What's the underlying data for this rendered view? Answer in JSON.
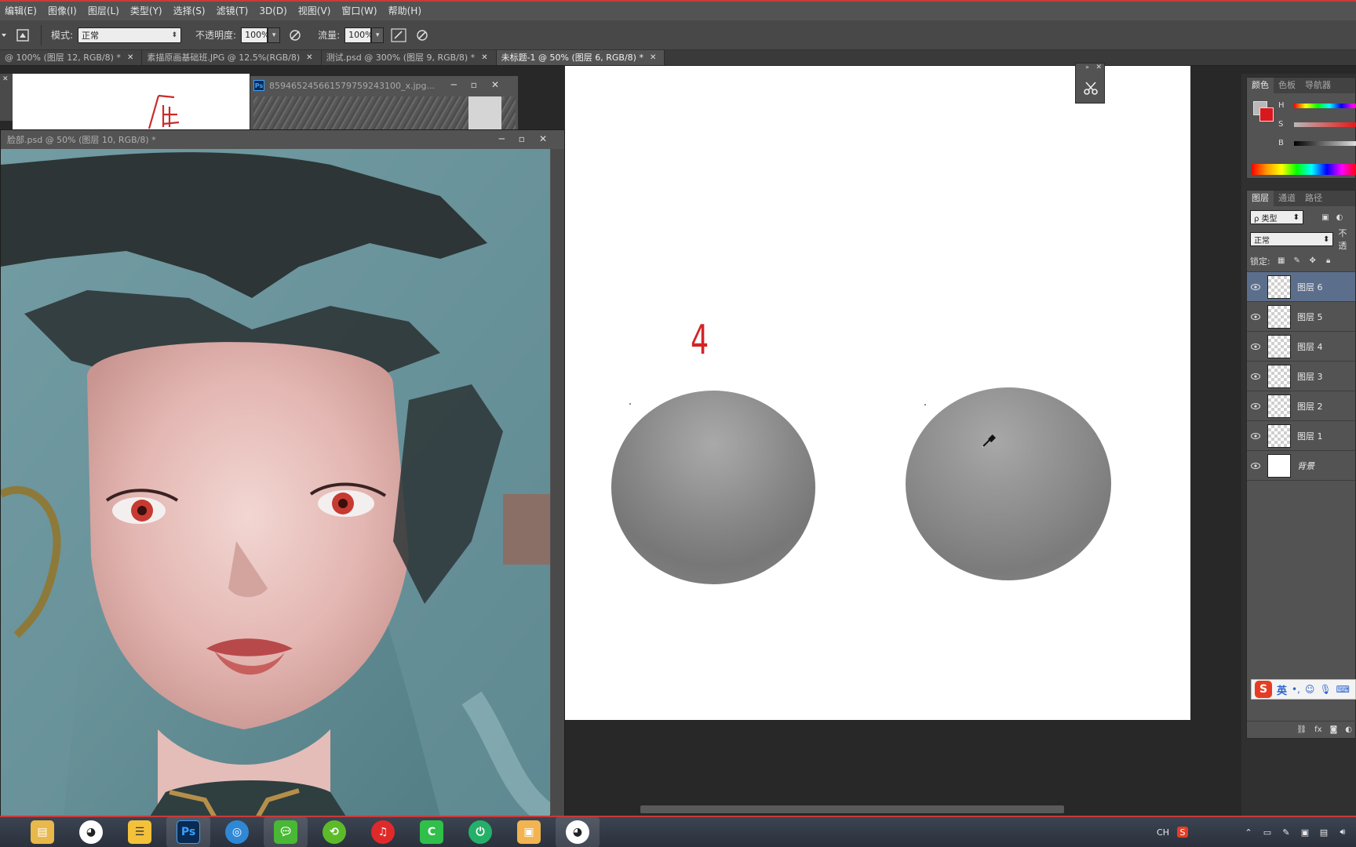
{
  "menu": [
    "编辑(E)",
    "图像(I)",
    "图层(L)",
    "类型(Y)",
    "选择(S)",
    "滤镜(T)",
    "3D(D)",
    "视图(V)",
    "窗口(W)",
    "帮助(H)"
  ],
  "options": {
    "mode_label": "模式:",
    "mode_value": "正常",
    "opacity_label": "不透明度:",
    "opacity_value": "100%",
    "flow_label": "流量:",
    "flow_value": "100%"
  },
  "doc_tabs": [
    {
      "label": "@ 100% (图层 12, RGB/8) *",
      "active": false
    },
    {
      "label": "素描原画基础班.JPG @ 12.5%(RGB/8)",
      "active": false
    },
    {
      "label": "测试.psd @ 300% (图层 9, RGB/8) *",
      "active": false
    },
    {
      "label": "未标题-1 @ 50% (图层 6, RGB/8) *",
      "active": true
    }
  ],
  "windows": {
    "photo_title": "859465245661579759243100_x.jpg...",
    "face_title": "脸部.psd @ 50% (图层 10, RGB/8) *"
  },
  "canvas": {
    "number_label": "4"
  },
  "color_panel": {
    "tabs": [
      "颜色",
      "色板",
      "导航器"
    ],
    "h_label": "H",
    "s_label": "S",
    "b_label": "B",
    "foreground": "#b8b8b8",
    "background": "#d8181c"
  },
  "layers_panel": {
    "tabs": [
      "图层",
      "通道",
      "路径"
    ],
    "filter_label": "ρ 类型",
    "blend_mode": "正常",
    "opacity_prefix": "不透",
    "lock_label": "锁定:",
    "layers": [
      {
        "name": "图层 6",
        "active": true
      },
      {
        "name": "图层 5",
        "active": false
      },
      {
        "name": "图层 4",
        "active": false
      },
      {
        "name": "图层 3",
        "active": false
      },
      {
        "name": "图层 2",
        "active": false
      },
      {
        "name": "图层 1",
        "active": false
      },
      {
        "name": "背景",
        "active": false
      }
    ]
  },
  "ime": {
    "mode_label": "英"
  },
  "taskbar": {
    "apps": [
      "file-explorer",
      "qq",
      "notepad",
      "photoshop",
      "browser",
      "wechat",
      "green-app",
      "netease-music",
      "green-app-2",
      "green-app-3",
      "folder",
      "qq-2"
    ],
    "tray_lang": "CH"
  },
  "colors": {
    "accent_red": "#c83a3a",
    "panel_bg": "#535353",
    "active_layer": "#5b6f8c"
  }
}
